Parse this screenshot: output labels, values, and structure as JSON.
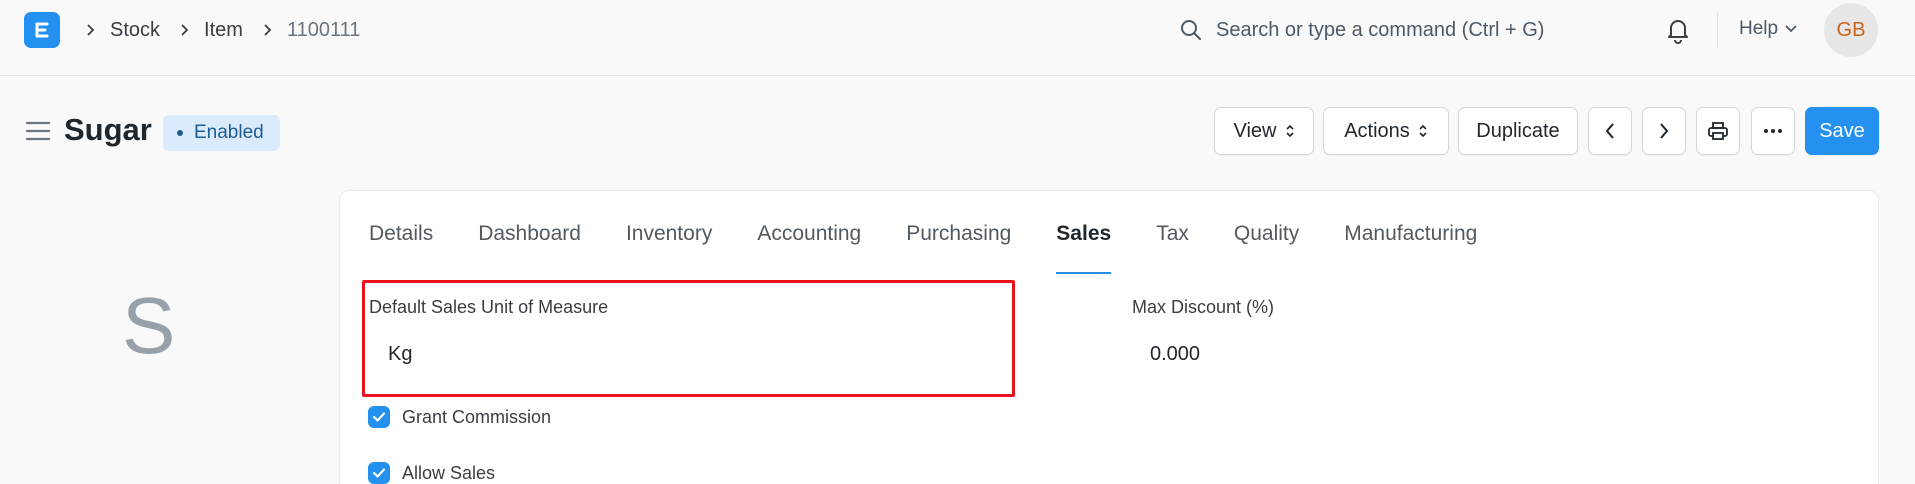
{
  "colors": {
    "primary": "#2490ef",
    "highlight": "#e8131d",
    "badge_bg": "#d9ebfc",
    "avatar_text": "#c9641d"
  },
  "navbar": {
    "logo_letter": "E",
    "breadcrumbs": [
      "Stock",
      "Item",
      "1100111"
    ],
    "search_placeholder": "Search or type a command (Ctrl + G)",
    "help_label": "Help",
    "avatar_initials": "GB"
  },
  "page": {
    "title": "Sugar",
    "status": "Enabled",
    "actions": {
      "view": "View",
      "actions": "Actions",
      "duplicate": "Duplicate",
      "save": "Save"
    }
  },
  "image_placeholder": {
    "letter": "S"
  },
  "tabs": [
    "Details",
    "Dashboard",
    "Inventory",
    "Accounting",
    "Purchasing",
    "Sales",
    "Tax",
    "Quality",
    "Manufacturing"
  ],
  "active_tab": "Sales",
  "form": {
    "default_sales_uom": {
      "label": "Default Sales Unit of Measure",
      "value": "Kg"
    },
    "max_discount": {
      "label": "Max Discount (%)",
      "value": "0.000"
    },
    "grant_commission": {
      "label": "Grant Commission",
      "checked": true
    },
    "allow_sales": {
      "label": "Allow Sales",
      "checked": true
    }
  }
}
